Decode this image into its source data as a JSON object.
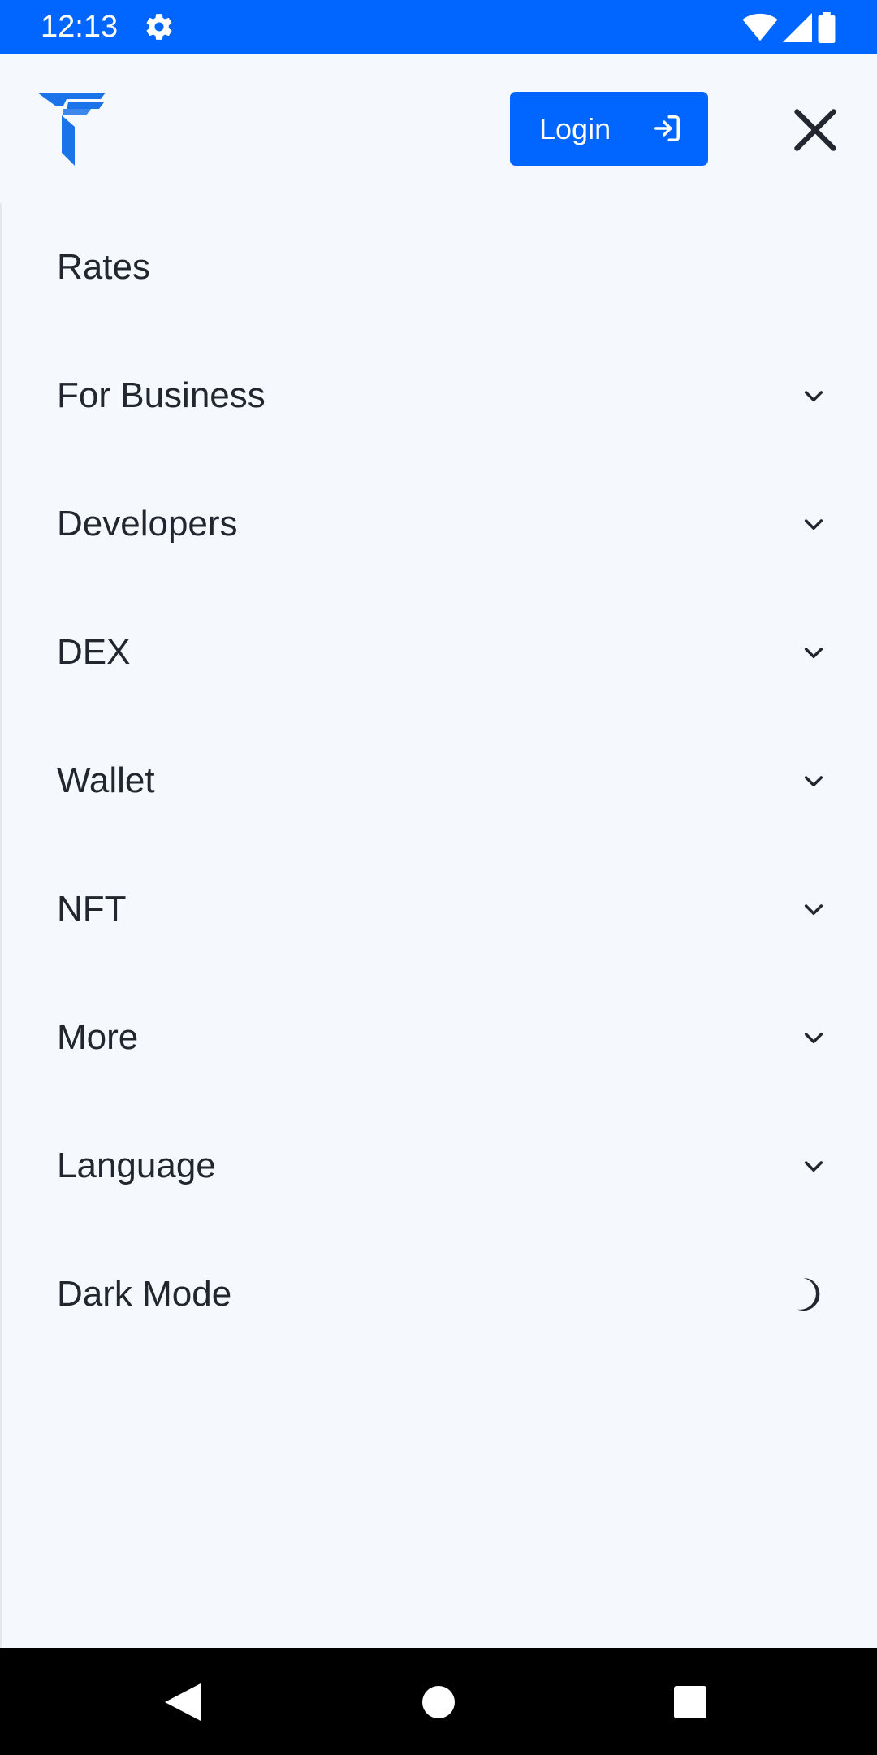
{
  "status_bar": {
    "time": "12:13",
    "left_icons": [
      "gear-icon"
    ],
    "right_icons": [
      "wifi-icon",
      "signal-icon",
      "battery-icon"
    ]
  },
  "header": {
    "logo": "brand-logo",
    "login_label": "Login",
    "login_icon": "login-arrow-icon",
    "close_icon": "close-icon"
  },
  "menu": {
    "items": [
      {
        "label": "Rates",
        "icon": ""
      },
      {
        "label": "For Business",
        "icon": "chevron-down-icon"
      },
      {
        "label": "Developers",
        "icon": "chevron-down-icon"
      },
      {
        "label": "DEX",
        "icon": "chevron-down-icon"
      },
      {
        "label": "Wallet",
        "icon": "chevron-down-icon"
      },
      {
        "label": "NFT",
        "icon": "chevron-down-icon"
      },
      {
        "label": "More",
        "icon": "chevron-down-icon"
      },
      {
        "label": "Language",
        "icon": "chevron-down-icon"
      },
      {
        "label": "Dark Mode",
        "icon": "moon-icon"
      }
    ]
  },
  "nav_bar": {
    "icons": [
      "back-icon",
      "home-icon",
      "recents-icon"
    ]
  },
  "colors": {
    "accent": "#0066ff",
    "logo_blue": "#1a73e8",
    "background": "#f5f8fd",
    "text": "#22262e"
  }
}
